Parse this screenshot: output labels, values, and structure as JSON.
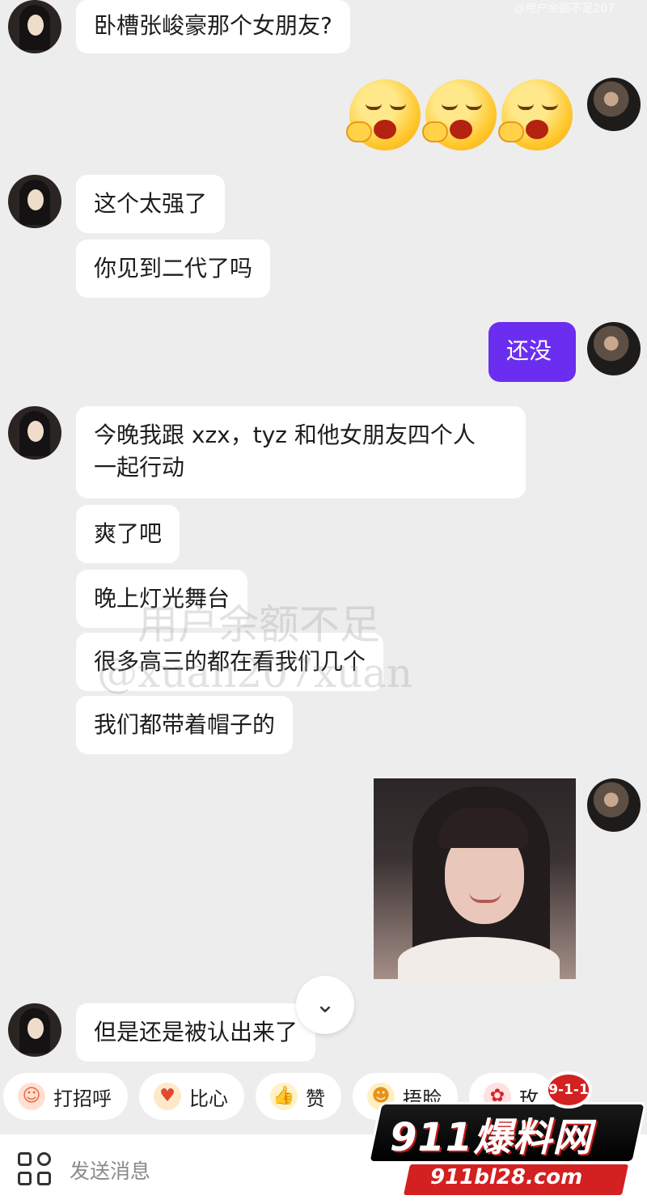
{
  "overlay": {
    "top_watermark": "@用户余额不足207",
    "watermark_line1": "用户余额不足",
    "watermark_line2": "@xuan207xuan"
  },
  "messages": [
    {
      "side": "left",
      "text": "卧槽张峻豪那个女朋友?"
    },
    {
      "side": "right",
      "type": "emoji",
      "emoji": "sleepy-face",
      "count": 3
    },
    {
      "side": "left",
      "text": "这个太强了"
    },
    {
      "side": "left",
      "text": "你见到二代了吗"
    },
    {
      "side": "right",
      "text": "还没"
    },
    {
      "side": "left",
      "text": "今晚我跟 xzx，tyz 和他女朋友四个人\n一起行动"
    },
    {
      "side": "left",
      "text": "爽了吧"
    },
    {
      "side": "left",
      "text": "晚上灯光舞台"
    },
    {
      "side": "left",
      "text": "很多高三的都在看我们几个"
    },
    {
      "side": "left",
      "text": "我们都带着帽子的"
    },
    {
      "side": "right",
      "type": "image",
      "description": "smiling-girl-photo"
    },
    {
      "side": "left",
      "text": "但是还是被认出来了"
    }
  ],
  "quick_replies": [
    {
      "label": "打招呼",
      "icon": "wave-emoji-icon",
      "glyph": "☺",
      "color": "#f0603a"
    },
    {
      "label": "比心",
      "icon": "heart-hands-icon",
      "glyph": "♥",
      "color": "#f2a12a"
    },
    {
      "label": "赞",
      "icon": "thumbs-up-icon",
      "glyph": "👍",
      "color": "#f7b733"
    },
    {
      "label": "捂脸",
      "icon": "facepalm-icon",
      "glyph": "☻",
      "color": "#f5b52a"
    },
    {
      "label": "玫",
      "icon": "rose-icon",
      "glyph": "✿",
      "color": "#d6262b"
    }
  ],
  "input": {
    "placeholder": "发送消息"
  },
  "scroll_button": {
    "glyph": "⌄"
  },
  "brand_badge": {
    "number": "9-1-1",
    "name": "911爆料网",
    "url": "911bl28.com"
  }
}
